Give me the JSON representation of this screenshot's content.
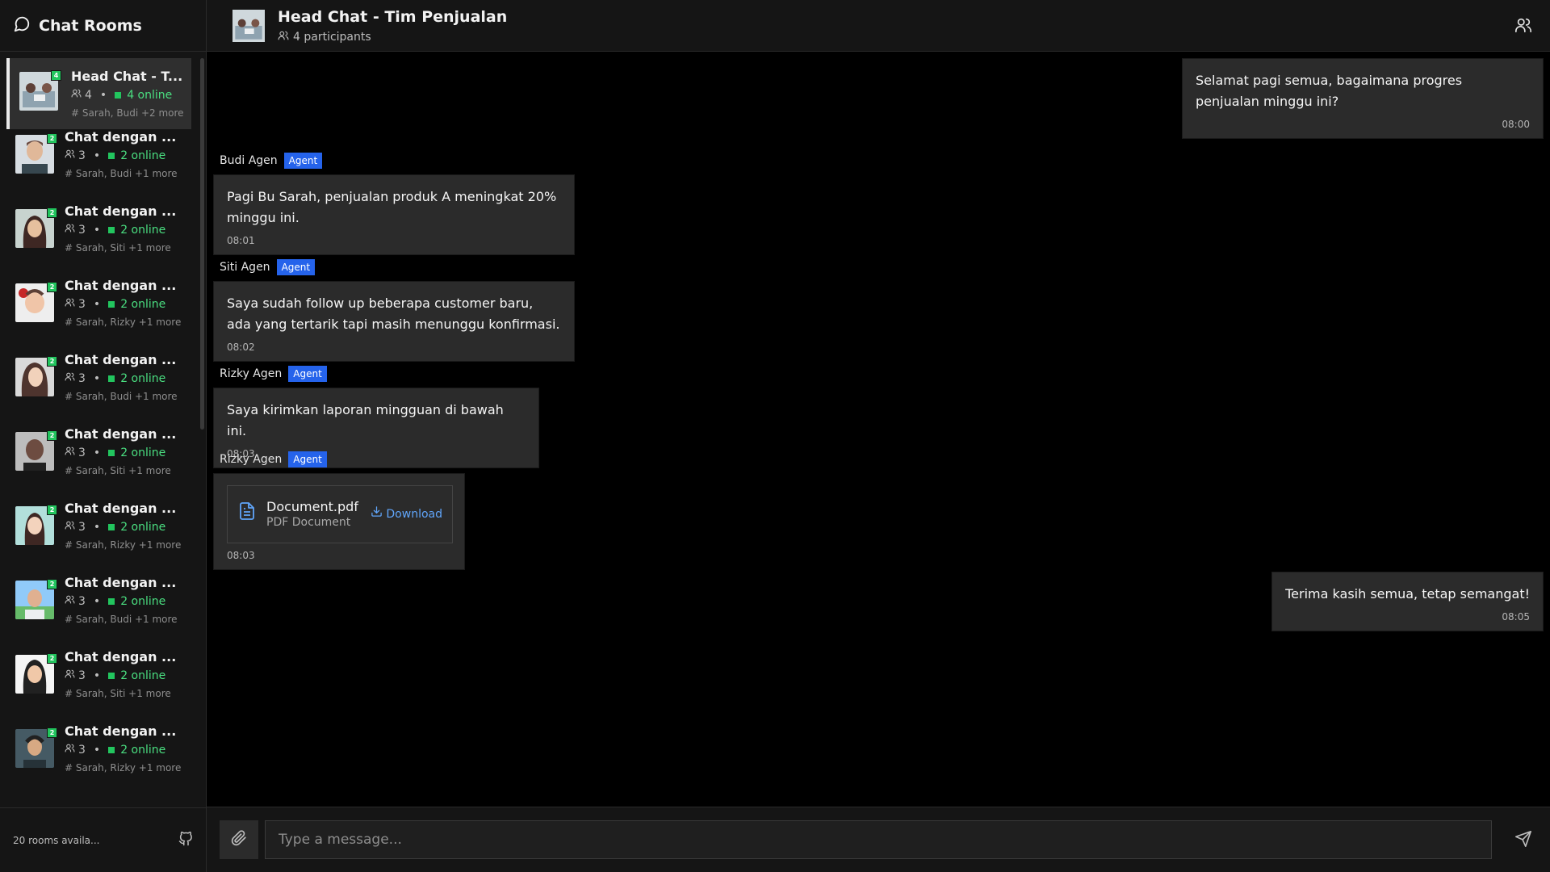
{
  "sidebar": {
    "title": "Chat Rooms",
    "footer_count": "20 rooms availa...",
    "rooms": [
      {
        "name": "Head Chat - T...",
        "badge": "4",
        "participants": "4",
        "online": "4 online",
        "members": "Sarah, Budi +2 more"
      },
      {
        "name": "Chat dengan ...",
        "badge": "2",
        "participants": "3",
        "online": "2 online",
        "members": "Sarah, Budi +1 more"
      },
      {
        "name": "Chat dengan ...",
        "badge": "2",
        "participants": "3",
        "online": "2 online",
        "members": "Sarah, Siti +1 more"
      },
      {
        "name": "Chat dengan ...",
        "badge": "2",
        "participants": "3",
        "online": "2 online",
        "members": "Sarah, Rizky +1 more"
      },
      {
        "name": "Chat dengan ...",
        "badge": "2",
        "participants": "3",
        "online": "2 online",
        "members": "Sarah, Budi +1 more"
      },
      {
        "name": "Chat dengan ...",
        "badge": "2",
        "participants": "3",
        "online": "2 online",
        "members": "Sarah, Siti +1 more"
      },
      {
        "name": "Chat dengan ...",
        "badge": "2",
        "participants": "3",
        "online": "2 online",
        "members": "Sarah, Rizky +1 more"
      },
      {
        "name": "Chat dengan ...",
        "badge": "2",
        "participants": "3",
        "online": "2 online",
        "members": "Sarah, Budi +1 more"
      },
      {
        "name": "Chat dengan ...",
        "badge": "2",
        "participants": "3",
        "online": "2 online",
        "members": "Sarah, Siti +1 more"
      },
      {
        "name": "Chat dengan ...",
        "badge": "2",
        "participants": "3",
        "online": "2 online",
        "members": "Sarah, Rizky +1 more"
      }
    ]
  },
  "chat": {
    "title": "Head Chat - Tim Penjualan",
    "participants": "4 participants"
  },
  "messages": [
    {
      "direction": "out",
      "text": "Selamat pagi semua, bagaimana progres penjualan minggu ini?",
      "time": "08:00"
    },
    {
      "direction": "in",
      "sender": "Budi Agen",
      "role": "Agent",
      "text": "Pagi Bu Sarah, penjualan produk A meningkat 20% minggu ini.",
      "time": "08:01"
    },
    {
      "direction": "in",
      "sender": "Siti Agen",
      "role": "Agent",
      "text": "Saya sudah follow up beberapa customer baru, ada yang tertarik tapi masih menunggu konfirmasi.",
      "time": "08:02"
    },
    {
      "direction": "in",
      "sender": "Rizky Agen",
      "role": "Agent",
      "text": "Saya kirimkan laporan mingguan di bawah ini.",
      "time": "08:03"
    },
    {
      "direction": "in",
      "sender": "Rizky Agen",
      "role": "Agent",
      "file_name": "Document.pdf",
      "file_type": "PDF Document",
      "download_label": "Download",
      "time": "08:03"
    },
    {
      "direction": "out",
      "text": "Terima kasih semua, tetap semangat!",
      "time": "08:05"
    }
  ],
  "composer": {
    "placeholder": "Type a message..."
  },
  "colors": {
    "accent_online": "#22c55e",
    "agent_tag": "#2563eb",
    "link": "#60a5fa"
  }
}
